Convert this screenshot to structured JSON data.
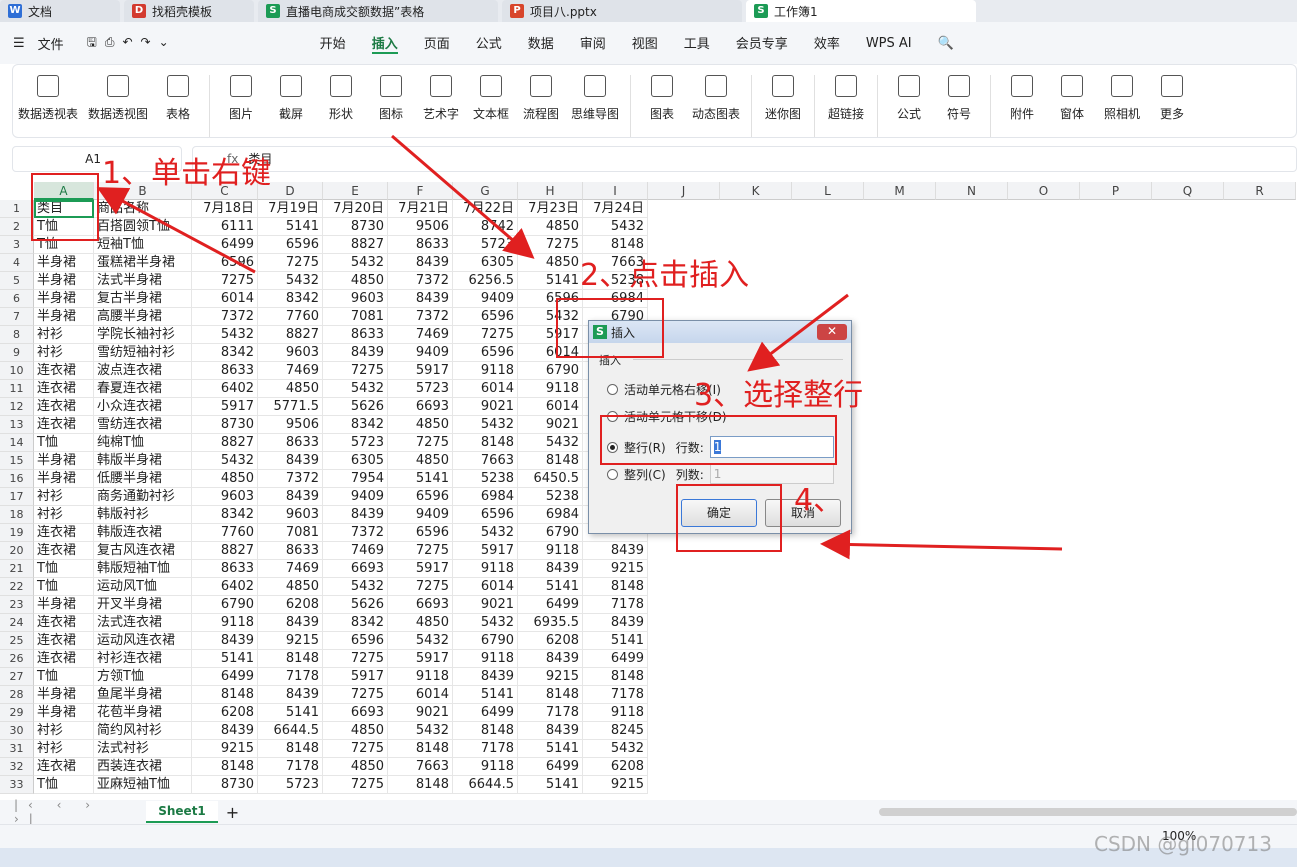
{
  "tabs": [
    {
      "label": "文档",
      "icon": "W",
      "color": "#2f6fd6"
    },
    {
      "label": "找稻壳模板",
      "icon": "D",
      "color": "#d33a2f"
    },
    {
      "label": "直播电商成交额数据”表格",
      "icon": "S",
      "color": "#1c9b55"
    },
    {
      "label": "项目八.pptx",
      "icon": "P",
      "color": "#d8452b"
    },
    {
      "label": "工作簿1",
      "icon": "S",
      "color": "#1c9b55"
    }
  ],
  "menu": {
    "file": "文件",
    "items": [
      "开始",
      "插入",
      "页面",
      "公式",
      "数据",
      "审阅",
      "视图",
      "工具",
      "会员专享",
      "效率"
    ],
    "wps_ai": "WPS AI"
  },
  "ribbon": [
    "数据透视表",
    "数据透视图",
    "表格",
    "图片",
    "截屏",
    "形状",
    "图标",
    "艺术字",
    "文本框",
    "流程图",
    "思维导图",
    "图表",
    "动态图表",
    "迷你图",
    "超链接",
    "公式",
    "符号",
    "附件",
    "窗体",
    "照相机",
    "更多"
  ],
  "formula": {
    "namebox": "A1",
    "fx": "fx",
    "content": "类目"
  },
  "columns": [
    "A",
    "B",
    "C",
    "D",
    "E",
    "F",
    "G",
    "H",
    "I",
    "J",
    "K",
    "L",
    "M",
    "N",
    "O",
    "P",
    "Q",
    "R"
  ],
  "header": [
    "类目",
    "商品名称",
    "7月18日",
    "7月19日",
    "7月20日",
    "7月21日",
    "7月22日",
    "7月23日",
    "7月24日"
  ],
  "rows": [
    [
      "T恤",
      "百搭圆领T恤",
      "6111",
      "5141",
      "8730",
      "9506",
      "8742",
      "4850",
      "5432"
    ],
    [
      "T恤",
      "短袖T恤",
      "6499",
      "6596",
      "8827",
      "8633",
      "5723",
      "7275",
      "8148"
    ],
    [
      "半身裙",
      "蛋糕裙半身裙",
      "6596",
      "7275",
      "5432",
      "8439",
      "6305",
      "4850",
      "7663"
    ],
    [
      "半身裙",
      "法式半身裙",
      "7275",
      "5432",
      "4850",
      "7372",
      "6256.5",
      "5141",
      "5238"
    ],
    [
      "半身裙",
      "复古半身裙",
      "6014",
      "8342",
      "9603",
      "8439",
      "9409",
      "6596",
      "6984"
    ],
    [
      "半身裙",
      "高腰半身裙",
      "7372",
      "7760",
      "7081",
      "7372",
      "6596",
      "5432",
      "6790"
    ],
    [
      "衬衫",
      "学院长袖衬衫",
      "5432",
      "8827",
      "8633",
      "7469",
      "7275",
      "5917",
      ""
    ],
    [
      "衬衫",
      "雪纺短袖衬衫",
      "8342",
      "9603",
      "8439",
      "9409",
      "6596",
      "6014",
      ""
    ],
    [
      "连衣裙",
      "波点连衣裙",
      "8633",
      "7469",
      "7275",
      "5917",
      "9118",
      "6790",
      ""
    ],
    [
      "连衣裙",
      "春夏连衣裙",
      "6402",
      "4850",
      "5432",
      "5723",
      "6014",
      "9118",
      ""
    ],
    [
      "连衣裙",
      "小众连衣裙",
      "5917",
      "5771.5",
      "5626",
      "6693",
      "9021",
      "6014",
      ""
    ],
    [
      "连衣裙",
      "雪纺连衣裙",
      "8730",
      "9506",
      "8342",
      "4850",
      "5432",
      "9021",
      ""
    ],
    [
      "T恤",
      "纯棉T恤",
      "8827",
      "8633",
      "5723",
      "7275",
      "8148",
      "5432",
      ""
    ],
    [
      "半身裙",
      "韩版半身裙",
      "5432",
      "8439",
      "6305",
      "4850",
      "7663",
      "8148",
      ""
    ],
    [
      "半身裙",
      "低腰半身裙",
      "4850",
      "7372",
      "7954",
      "5141",
      "5238",
      "6450.5",
      ""
    ],
    [
      "衬衫",
      "商务通勤衬衫",
      "9603",
      "8439",
      "9409",
      "6596",
      "6984",
      "5238",
      ""
    ],
    [
      "衬衫",
      "韩版衬衫",
      "8342",
      "9603",
      "8439",
      "9409",
      "6596",
      "6984",
      ""
    ],
    [
      "连衣裙",
      "韩版连衣裙",
      "7760",
      "7081",
      "7372",
      "6596",
      "5432",
      "6790",
      ""
    ],
    [
      "连衣裙",
      "复古风连衣裙",
      "8827",
      "8633",
      "7469",
      "7275",
      "5917",
      "9118",
      "8439"
    ],
    [
      "T恤",
      "韩版短袖T恤",
      "8633",
      "7469",
      "6693",
      "5917",
      "9118",
      "8439",
      "9215"
    ],
    [
      "T恤",
      "运动风T恤",
      "6402",
      "4850",
      "5432",
      "7275",
      "6014",
      "5141",
      "8148"
    ],
    [
      "半身裙",
      "开叉半身裙",
      "6790",
      "6208",
      "5626",
      "6693",
      "9021",
      "6499",
      "7178"
    ],
    [
      "连衣裙",
      "法式连衣裙",
      "9118",
      "8439",
      "8342",
      "4850",
      "5432",
      "6935.5",
      "8439"
    ],
    [
      "连衣裙",
      "运动风连衣裙",
      "8439",
      "9215",
      "6596",
      "5432",
      "6790",
      "6208",
      "5141"
    ],
    [
      "连衣裙",
      "衬衫连衣裙",
      "5141",
      "8148",
      "7275",
      "5917",
      "9118",
      "8439",
      "6499"
    ],
    [
      "T恤",
      "方领T恤",
      "6499",
      "7178",
      "5917",
      "9118",
      "8439",
      "9215",
      "8148"
    ],
    [
      "半身裙",
      "鱼尾半身裙",
      "8148",
      "8439",
      "7275",
      "6014",
      "5141",
      "8148",
      "7178"
    ],
    [
      "半身裙",
      "花苞半身裙",
      "6208",
      "5141",
      "6693",
      "9021",
      "6499",
      "7178",
      "9118"
    ],
    [
      "衬衫",
      "简约风衬衫",
      "8439",
      "6644.5",
      "4850",
      "5432",
      "8148",
      "8439",
      "8245"
    ],
    [
      "衬衫",
      "法式衬衫",
      "9215",
      "8148",
      "7275",
      "8148",
      "7178",
      "5141",
      "5432"
    ],
    [
      "连衣裙",
      "西装连衣裙",
      "8148",
      "7178",
      "4850",
      "7663",
      "9118",
      "6499",
      "6208"
    ],
    [
      "T恤",
      "亚麻短袖T恤",
      "8730",
      "5723",
      "7275",
      "8148",
      "6644.5",
      "5141",
      "9215"
    ]
  ],
  "dialog": {
    "title": "插入",
    "group": "插入",
    "opt1": "活动单元格右移(I)",
    "opt2": "活动单元格下移(D)",
    "opt3": "整行(R)",
    "rows_label": "行数:",
    "rows_value": "1",
    "opt4": "整列(C)",
    "cols_label": "列数:",
    "cols_value": "1",
    "ok": "确定",
    "cancel": "取消"
  },
  "annotations": {
    "a1": "1、单击右键",
    "a2": "2、点击插入",
    "a3": "3、选择整行",
    "a4": "4、"
  },
  "sheet": {
    "name": "Sheet1",
    "zoom": "100%"
  },
  "watermark": "CSDN @gl070713"
}
